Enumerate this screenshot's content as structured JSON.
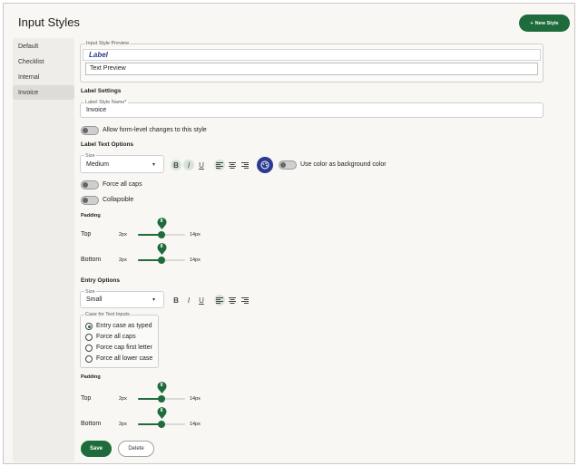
{
  "header": {
    "title": "Input Styles",
    "new_style_label": "New Style",
    "new_style_icon": "+"
  },
  "sidebar": {
    "items": [
      {
        "label": "Default"
      },
      {
        "label": "Checklist"
      },
      {
        "label": "Internal"
      },
      {
        "label": "Invoice"
      }
    ],
    "active_index": 3
  },
  "preview": {
    "legend": "Input Style Preview",
    "label_text": "Label",
    "field_text": "Text Preview"
  },
  "label_settings": {
    "title": "Label Settings",
    "name_legend": "Label Style Name*",
    "name_value": "Invoice",
    "allow_changes_label": "Allow form-level changes to this style",
    "allow_changes_on": false
  },
  "label_text_options": {
    "title": "Label Text Options",
    "size_legend": "Size",
    "size_value": "Medium",
    "bold_glyph": "B",
    "italic_glyph": "I",
    "underline_glyph": "U",
    "use_color_bg_label": "Use color as background color",
    "use_color_bg_on": false,
    "force_caps_label": "Force all caps",
    "force_caps_on": false,
    "collapsible_label": "Collapsible",
    "collapsible_on": false
  },
  "label_padding": {
    "title": "Padding",
    "rows": [
      {
        "label": "Top",
        "min": "2px",
        "max": "14px",
        "value": "8",
        "fraction": 0.5
      },
      {
        "label": "Bottom",
        "min": "2px",
        "max": "14px",
        "value": "8",
        "fraction": 0.5
      }
    ]
  },
  "entry_options": {
    "title": "Entry Options",
    "size_legend": "Size",
    "size_value": "Small",
    "bold_glyph": "B",
    "italic_glyph": "I",
    "underline_glyph": "U",
    "case_legend": "Case for Text Inputs",
    "case_options": [
      {
        "label": "Entry case as typed",
        "selected": true
      },
      {
        "label": "Force all caps",
        "selected": false
      },
      {
        "label": "Force cap first letter",
        "selected": false
      },
      {
        "label": "Force all lower case",
        "selected": false
      }
    ]
  },
  "entry_padding": {
    "title": "Padding",
    "rows": [
      {
        "label": "Top",
        "min": "2px",
        "max": "14px",
        "value": "8",
        "fraction": 0.5
      },
      {
        "label": "Bottom",
        "min": "2px",
        "max": "14px",
        "value": "8",
        "fraction": 0.5
      }
    ]
  },
  "actions": {
    "save_label": "Save",
    "delete_label": "Delete"
  },
  "colors": {
    "accent": "#1e6b3b",
    "color_picker": "#2b3b8f",
    "label_preview": "#2e3f93"
  }
}
